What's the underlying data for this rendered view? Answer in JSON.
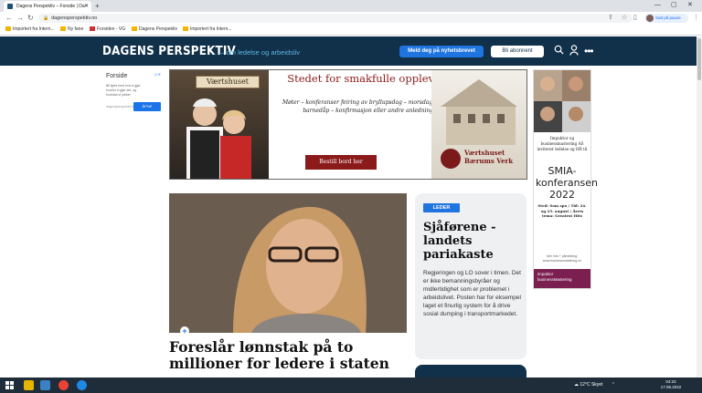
{
  "browser": {
    "tab_title": "Dagens Perspektiv – Forside | Da",
    "url": "dagensperspektiv.no",
    "pause_label": "Satt på pause",
    "bookmarks": [
      "Importert fra Intern...",
      "Ny fane",
      "Forsiden - VG",
      "Dagens Perspektiv",
      "Importert fra Intern..."
    ]
  },
  "site": {
    "logo": "DAGENS PERSPEKTIV",
    "tagline": "— om ledelse og arbeidsliv",
    "newsletter_button": "Meld deg på nyhetsbrevet",
    "subscribe_button": "Bli abonnent"
  },
  "left_ad": {
    "title": "Forside",
    "desc": "Bli kjent med hva vi gjør, hvorfor vi gjør det, og hvordan vi jobber",
    "input_placeholder": "dagensperspektiv.no",
    "button": "ÅPNE"
  },
  "banner": {
    "sign": "Værtshuset",
    "headline": "Stedet for smakfulle opplevelser",
    "sub": "Møter – konferanser feiring av bryllupsdag – morsdag farsdag – barnedåp – konfirmasjon eller andre anledninger",
    "cta": "Bestill bord her",
    "brand": "Værtshuset Bærums Verk"
  },
  "right_ad": {
    "text1": "Impuktor og businessmastering AS inviterer ledelse og HR til",
    "big": "SMIA-konferansen 2022",
    "text2": "Sted: Som spa / Tid: 24. og 25. august / Årets tema: Greatest Hits",
    "text3": "Mer info + påmelding: www.businessmastering.no",
    "foot1": "impaktor",
    "foot2": "businessMastering"
  },
  "main_article": {
    "headline": "Foreslår lønnstak på to millioner for ledere i staten"
  },
  "leader": {
    "badge": "LEDER",
    "headline": "Sjåførene - landets pariakaste",
    "body": "Regjeringen og LO sover i timen. Det er ikke bemanningsbyråer og midlertidighet som er problemet i arbeidslivet. Posten har for eksempel laget et finurlig system for å drive sosial dumping i transportmarkedet."
  },
  "taskbar": {
    "weather": "12°C Skyet",
    "time": "04:22",
    "date": "17.06.2022"
  }
}
